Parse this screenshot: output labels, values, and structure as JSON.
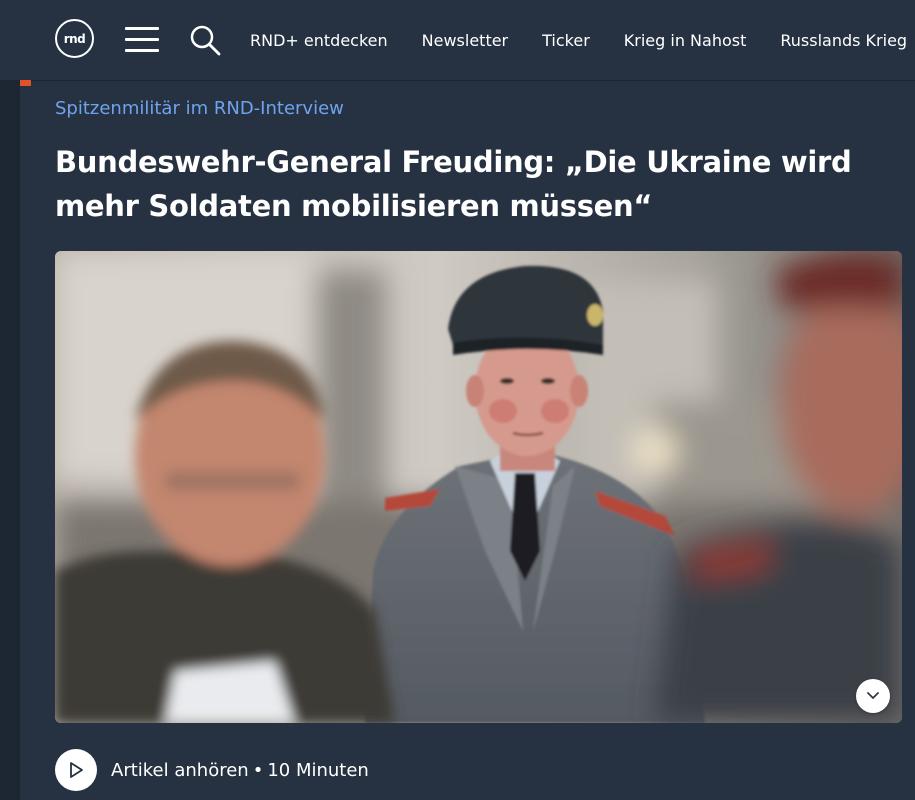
{
  "header": {
    "logo_text": "rnd",
    "nav_items": [
      "RND+ entdecken",
      "Newsletter",
      "Ticker",
      "Krieg in Nahost",
      "Russlands Krieg"
    ]
  },
  "article": {
    "kicker": "Spitzenmilitär im RND-Interview",
    "headline": "Bundeswehr-General Freuding: „Die Ukraine wird mehr Soldaten mobilisieren müssen“",
    "audio_label": "Artikel anhören",
    "audio_separator": "•",
    "audio_duration": "10 Minuten"
  },
  "icons": {
    "menu": "hamburger-icon",
    "search": "search-icon",
    "expand": "chevron-down-icon",
    "play": "play-icon"
  },
  "colors": {
    "background": "#263241",
    "kicker": "#6fa3ee",
    "accent": "#e4502a",
    "text": "#ffffff"
  }
}
